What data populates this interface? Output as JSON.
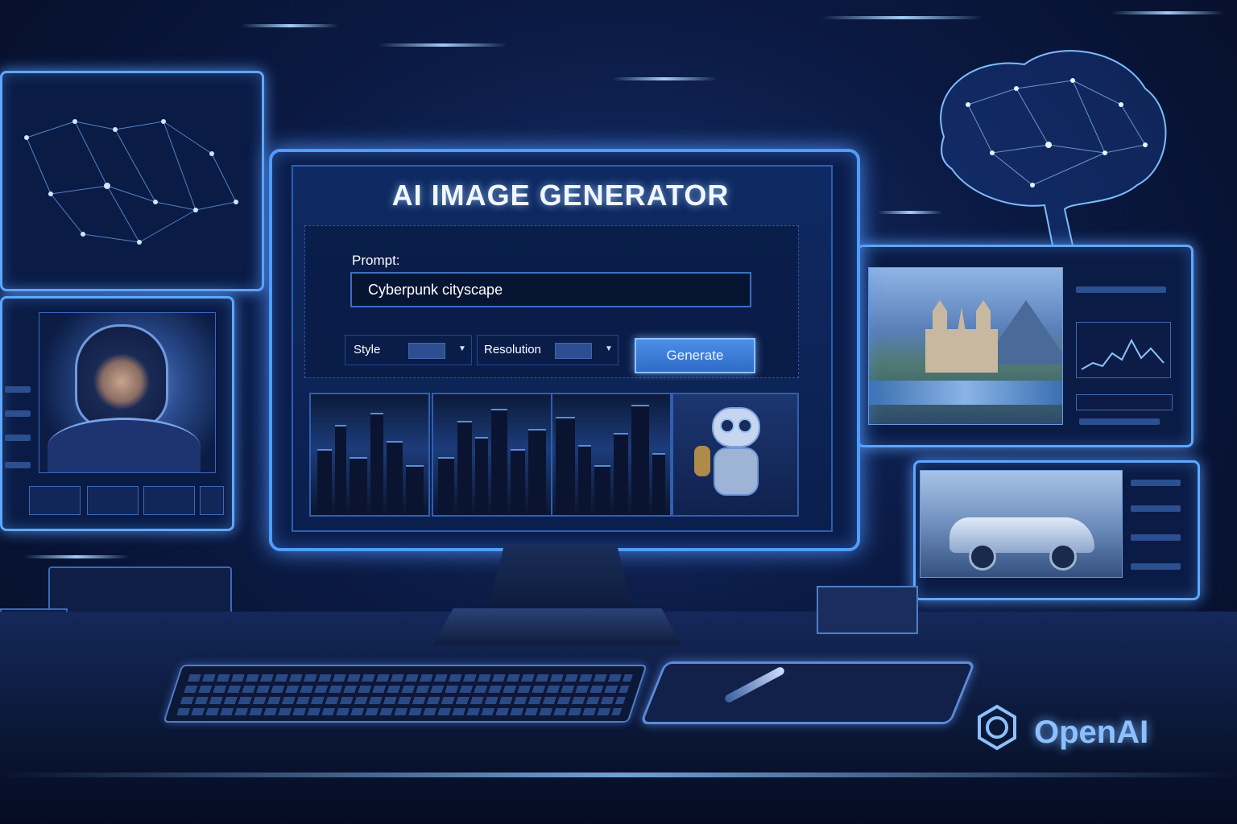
{
  "app": {
    "title": "AI IMAGE GENERATOR"
  },
  "form": {
    "prompt_label": "Prompt:",
    "prompt_value": "Cyberpunk cityscape",
    "style_label": "Style",
    "resolution_label": "Resolution",
    "generate_label": "Generate"
  },
  "results": [
    {
      "subject": "cyberpunk-city"
    },
    {
      "subject": "cyberpunk-city"
    },
    {
      "subject": "cyberpunk-city"
    },
    {
      "subject": "robot"
    }
  ],
  "brand": {
    "name": "OpenAI"
  },
  "colors": {
    "accent": "#4f9dff",
    "background": "#0b1a44",
    "button": "#3a7ad8",
    "brand_text": "#8cc0ff"
  },
  "icons": [
    "chevron-down-icon",
    "openai-logo-icon",
    "brain-network-icon",
    "constellation-network-icon"
  ]
}
